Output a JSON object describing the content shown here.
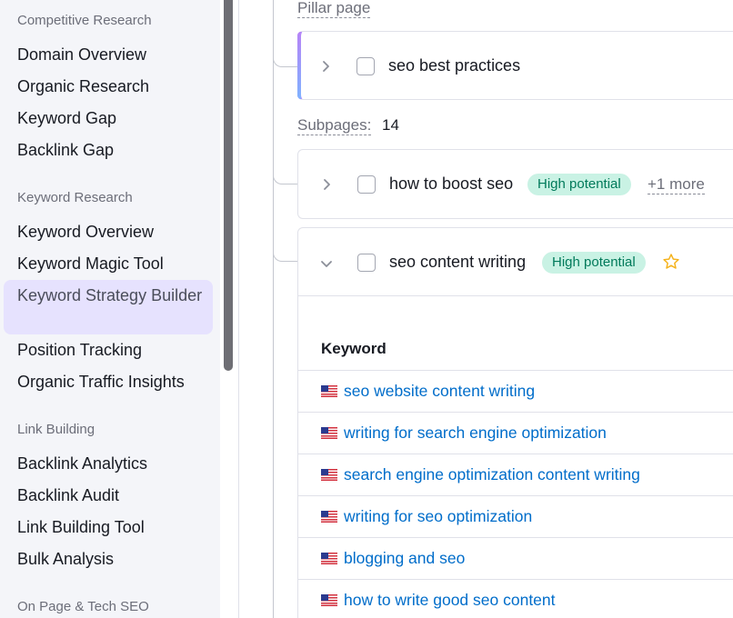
{
  "sidebar": {
    "sections": [
      {
        "title": "Competitive Research",
        "items": [
          "Domain Overview",
          "Organic Research",
          "Keyword Gap",
          "Backlink Gap"
        ]
      },
      {
        "title": "Keyword Research",
        "items": [
          "Keyword Overview",
          "Keyword Magic Tool",
          "Keyword Strategy Builder",
          "Position Tracking",
          "Organic Traffic Insights"
        ]
      },
      {
        "title": "Link Building",
        "items": [
          "Backlink Analytics",
          "Backlink Audit",
          "Link Building Tool",
          "Bulk Analysis"
        ]
      },
      {
        "title": "On Page & Tech SEO",
        "items": []
      }
    ],
    "active_item": "Keyword Strategy Builder"
  },
  "main": {
    "pillar_label": "Pillar page",
    "pillar": {
      "topic": "seo best practices"
    },
    "subpages_label": "Subpages:",
    "subpages_count": "14",
    "subpages": [
      {
        "topic": "how to boost seo",
        "badge": "High potential",
        "more": "+1 more",
        "expanded": false
      },
      {
        "topic": "seo content writing",
        "badge": "High potential",
        "starred": true,
        "expanded": true
      }
    ],
    "keyword_table": {
      "header": "Keyword",
      "rows": [
        "seo website content writing",
        "writing for search engine optimization",
        "search engine optimization content writing",
        "writing for seo optimization",
        "blogging and seo",
        "how to write good seo content"
      ]
    }
  },
  "colors": {
    "accent_active": "#e6e2fe",
    "badge_bg": "#c9f2e4",
    "badge_text": "#007a5a",
    "link": "#006dca",
    "star": "#f5b31d"
  },
  "icons": {
    "chevron_right": "chevron-right-icon",
    "chevron_down": "chevron-down-icon",
    "star": "star-outline-icon",
    "flag": "us-flag-icon"
  }
}
